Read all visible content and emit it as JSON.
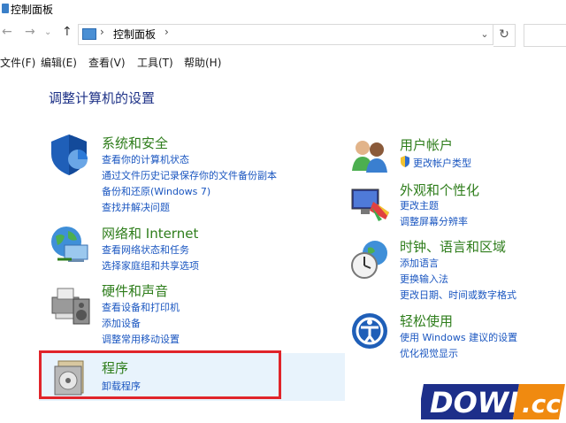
{
  "window": {
    "title": "控制面板"
  },
  "nav": {
    "back": "←",
    "forward": "→",
    "up": "↑",
    "dropdown": "⌄",
    "refresh": "↻"
  },
  "address": {
    "sep": "›",
    "path": "控制面板",
    "sep2": "›"
  },
  "menu": [
    "文件(F)",
    "编辑(E)",
    "查看(V)",
    "工具(T)",
    "帮助(H)"
  ],
  "page_title": "调整计算机的设置",
  "left_categories": [
    {
      "title": "系统和安全",
      "links": [
        "查看你的计算机状态",
        "通过文件历史记录保存你的文件备份副本",
        "备份和还原(Windows 7)",
        "查找并解决问题"
      ]
    },
    {
      "title": "网络和 Internet",
      "links": [
        "查看网络状态和任务",
        "选择家庭组和共享选项"
      ]
    },
    {
      "title": "硬件和声音",
      "links": [
        "查看设备和打印机",
        "添加设备",
        "调整常用移动设置"
      ]
    },
    {
      "title": "程序",
      "links": [
        "卸载程序"
      ]
    }
  ],
  "right_categories": [
    {
      "title": "用户帐户",
      "links": [
        "更改帐户类型"
      ]
    },
    {
      "title": "外观和个性化",
      "links": [
        "更改主题",
        "调整屏幕分辨率"
      ]
    },
    {
      "title": "时钟、语言和区域",
      "links": [
        "添加语言",
        "更换输入法",
        "更改日期、时间或数字格式"
      ]
    },
    {
      "title": "轻松使用",
      "links": [
        "使用 Windows 建议的设置",
        "优化视觉显示"
      ]
    }
  ],
  "watermark": {
    "text": "DOWN",
    "suffix": ".cc"
  },
  "colors": {
    "category_green": "#2e7d1b",
    "link_blue": "#1a56c0",
    "title_blue": "#1e3287",
    "highlight": "#e8f3fc",
    "frame_red": "#e0242a"
  }
}
